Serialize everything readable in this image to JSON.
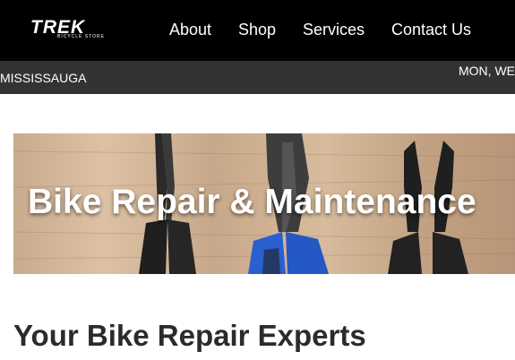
{
  "brand": {
    "logo_word": "TREK",
    "logo_sub": "BICYCLE STORE"
  },
  "nav": {
    "about": "About",
    "shop": "Shop",
    "services": "Services",
    "contact": "Contact Us"
  },
  "infobar": {
    "location": "MISSISSAUGA",
    "hours": "MON, WE"
  },
  "hero": {
    "title": "Bike Repair & Maintenance"
  },
  "main": {
    "section_title": "Your Bike Repair Experts"
  },
  "colors": {
    "topbar": "#000000",
    "infobar": "#333333",
    "hero_wood": "#d2b596",
    "tool_blue": "#2a5fd0",
    "tool_black": "#1f1f1f"
  }
}
